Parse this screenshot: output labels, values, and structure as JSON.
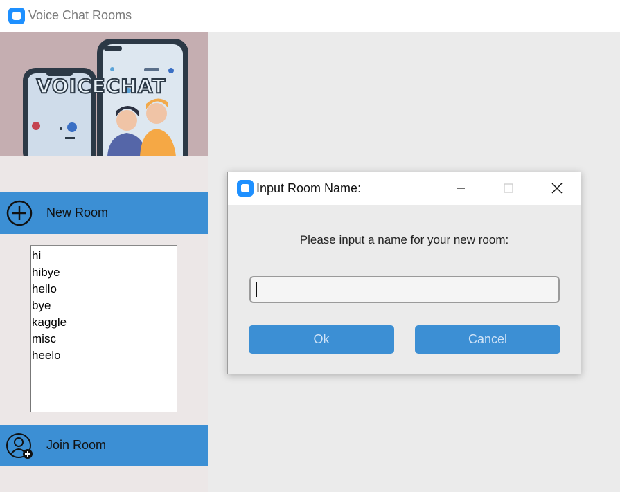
{
  "window": {
    "title": "Voice Chat Rooms"
  },
  "banner": {
    "logo_text": "VOICECHAT"
  },
  "sidebar": {
    "new_room_label": "New Room",
    "join_room_label": "Join Room",
    "rooms": [
      "hi",
      "hibye",
      "hello",
      "bye",
      "kaggle",
      "misc",
      "heelo"
    ]
  },
  "dialog": {
    "title": "Input Room Name:",
    "prompt": "Please input a name for your new room:",
    "input_value": "",
    "ok_label": "Ok",
    "cancel_label": "Cancel"
  },
  "colors": {
    "accent": "#3c8fd4",
    "app_icon": "#1e90ff",
    "banner_bg": "#c5aeb1"
  }
}
